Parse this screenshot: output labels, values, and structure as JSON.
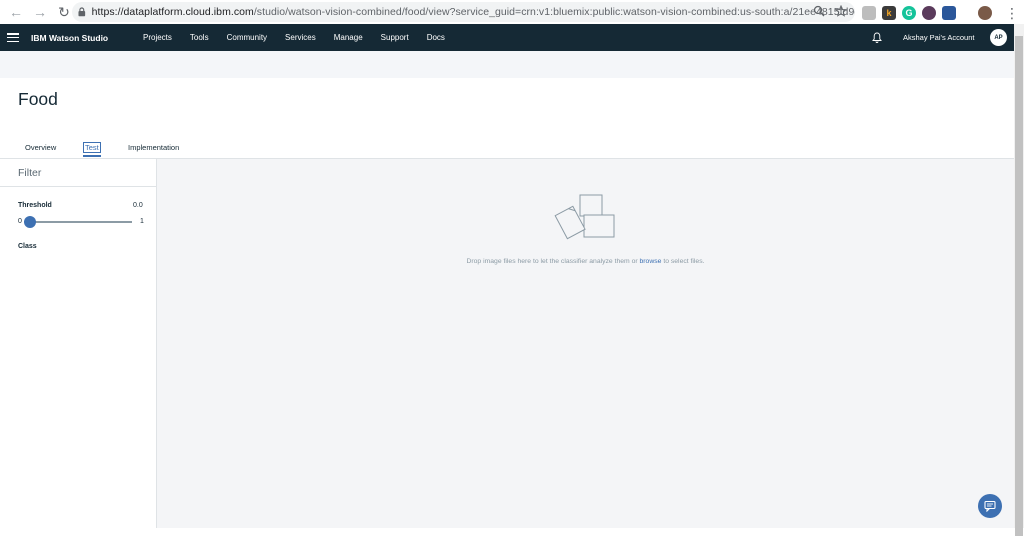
{
  "browser": {
    "url_host": "https://dataplatform.cloud.ibm.com",
    "url_path": "/studio/watson-vision-combined/food/view?service_guid=crn:v1:bluemix:public:watson-vision-combined:us-south:a/21ee4815fd9d4118...",
    "back_glyph": "←",
    "forward_glyph": "→",
    "reload_glyph": "↻",
    "menu_glyph": "⋮",
    "extensions": [
      {
        "name": "k",
        "color": "#f5a623"
      },
      {
        "name": "G",
        "color": "#15c39a"
      },
      {
        "name": "●",
        "color": "#5b3b5c"
      },
      {
        "name": "⊞",
        "color": "#2b579a"
      }
    ]
  },
  "header": {
    "brand_bold": "IBM Watson Studio",
    "nav": [
      "Projects",
      "Tools",
      "Community",
      "Services",
      "Manage",
      "Support",
      "Docs"
    ],
    "account": "Akshay Pai's Account",
    "avatar_initials": "AP"
  },
  "page": {
    "title": "Food",
    "tabs": [
      "Overview",
      "Test",
      "Implementation"
    ]
  },
  "sidebar": {
    "filter_title": "Filter",
    "threshold_label": "Threshold",
    "threshold_value": "0.0",
    "slider_min": "0",
    "slider_max": "1",
    "slider_level": 0.0,
    "class_label": "Class"
  },
  "dropzone": {
    "text_before": "Drop image files here to let the classifier analyze them or ",
    "link": "browse",
    "text_after": " to select files."
  },
  "colors": {
    "header_bg": "#152935",
    "accent": "#3d70b2"
  }
}
